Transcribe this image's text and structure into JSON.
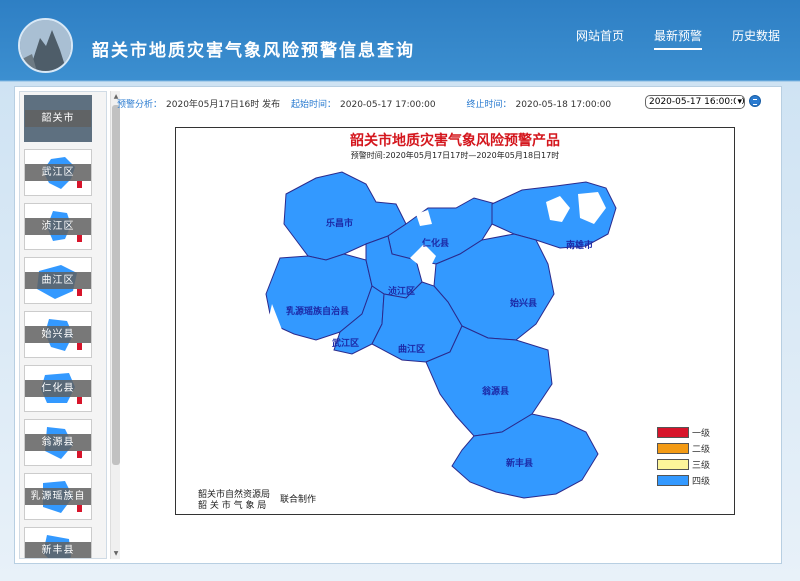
{
  "header": {
    "title": "韶关市地质灾害气象风险预警信息查询",
    "nav": [
      {
        "label": "网站首页",
        "active": false
      },
      {
        "label": "最新预警",
        "active": true
      },
      {
        "label": "历史数据",
        "active": false
      }
    ]
  },
  "sidebar": {
    "items": [
      {
        "label": "韶关市",
        "selected": true
      },
      {
        "label": "武江区",
        "selected": false
      },
      {
        "label": "浈江区",
        "selected": false
      },
      {
        "label": "曲江区",
        "selected": false
      },
      {
        "label": "始兴县",
        "selected": false
      },
      {
        "label": "仁化县",
        "selected": false
      },
      {
        "label": "翁源县",
        "selected": false
      },
      {
        "label": "乳源瑶族自",
        "selected": false
      },
      {
        "label": "新丰县",
        "selected": false
      }
    ]
  },
  "infobar": {
    "analysis_label": "预警分析：",
    "issued": "2020年05月17日16时 发布",
    "start_label": "起始时间：",
    "start": "2020-05-17 17:00:00",
    "end_label": "终止时间：",
    "end": "2020-05-18 17:00:00",
    "time_select": "2020-05-17 16:00:00"
  },
  "product": {
    "title": "韶关市地质灾害气象风险预警产品",
    "period": "预警时间:2020年05月17日17时—2020年05月18日17时",
    "regions": {
      "lechang": "乐昌市",
      "renhua": "仁化县",
      "nanxiong": "南雄市",
      "zhenjiang": "浈江区",
      "ruyuan": "乳源瑶族自治县",
      "shixing": "始兴县",
      "wujiang": "武江区",
      "qujiang": "曲江区",
      "wengyuan": "翁源县",
      "xinfeng": "新丰县"
    },
    "legend": [
      {
        "label": "一级",
        "color": "#d7142a"
      },
      {
        "label": "二级",
        "color": "#f39a14"
      },
      {
        "label": "三级",
        "color": "#fdf59a"
      },
      {
        "label": "四级",
        "color": "#3399ff"
      }
    ],
    "credit_line1": "韶关市自然资源局",
    "credit_line2": "韶 关 市 气 象 局",
    "credit_right": "联合制作"
  },
  "colors": {
    "header_blue": "#2e7fc4",
    "warning_blue": "#3399ff",
    "boundary": "#2b2a8c",
    "title_red": "#d4161d"
  }
}
